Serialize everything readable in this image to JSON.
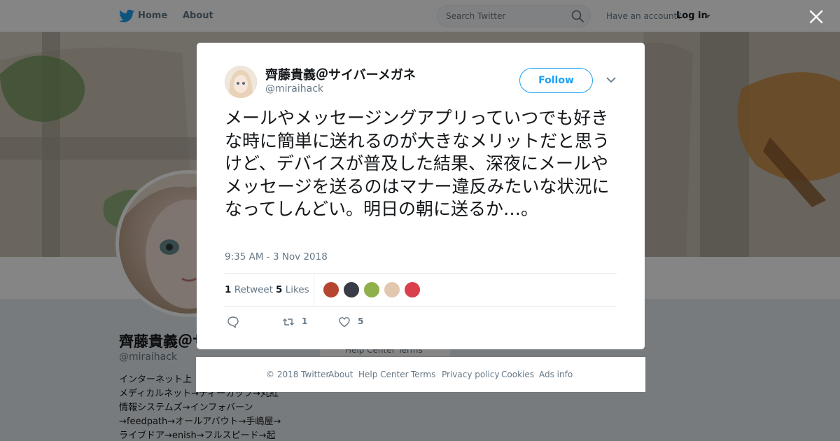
{
  "nav": {
    "home_label": "Home",
    "about_label": "About",
    "search_placeholder": "Search Twitter",
    "account_prompt": "Have an account?",
    "login_label": "Log in",
    "brand_color": "#1da1f2"
  },
  "background_profile": {
    "name": "齊藤貴義＠サ",
    "handle": "@miraihack",
    "bio_lines": [
      "インターネット上",
      "メディカルネット→ディーカップ→丸紅",
      "情報システムズ→インフォバーン",
      "→feedpath→オールアバウト→手嶋屋→",
      "ライブドア→enish→フルスピード→起"
    ],
    "footer_peek": "Help Center   Terms"
  },
  "tweet": {
    "author_name": "齊藤貴義＠サイバーメガネ",
    "author_handle": "@miraihack",
    "follow_label": "Follow",
    "text": "メールやメッセージングアプリっていつでも好きな時に簡単に送れるのが大きなメリットだと思うけど、デバイスが普及した結果、深夜にメールやメッセージを送るのはマナー違反みたいな状況になってしんどい。明日の朝に送るか…。",
    "timestamp": "9:35 AM - 3 Nov 2018",
    "retweet_count": "1",
    "retweet_label": "Retweet",
    "like_count": "5",
    "like_label": "Likes",
    "action_retweet_count": "1",
    "action_like_count": "5"
  },
  "likers": [
    {
      "color": "#b5452f"
    },
    {
      "color": "#3b3b48"
    },
    {
      "color": "#8fb04a"
    },
    {
      "color": "#e3c8b0"
    },
    {
      "color": "#d9404b"
    }
  ],
  "footer": {
    "copyright": "© 2018 Twitter",
    "about": "About",
    "help": "Help Center",
    "terms": "Terms",
    "privacy": "Privacy policy",
    "cookies": "Cookies",
    "ads": "Ads info"
  }
}
